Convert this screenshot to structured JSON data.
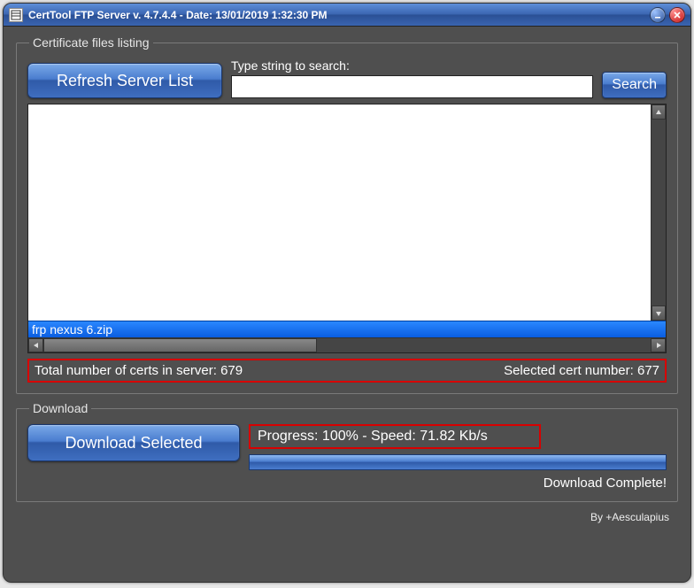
{
  "window": {
    "title": "CertTool FTP Server v. 4.7.4.4 - Date: 13/01/2019 1:32:30 PM"
  },
  "listing": {
    "legend": "Certificate files listing",
    "refresh_label": "Refresh Server List",
    "search_label": "Type string to search:",
    "search_value": "",
    "search_btn": "Search",
    "selected_file": "frp nexus 6.zip",
    "total_label": "Total number of certs in server: 679",
    "selected_label": "Selected cert number: 677"
  },
  "download": {
    "legend": "Download",
    "btn_label": "Download Selected",
    "progress_text": "Progress: 100% - Speed: 71.82 Kb/s",
    "complete_text": "Download Complete!"
  },
  "footer": {
    "credit": "By +Aesculapius"
  }
}
